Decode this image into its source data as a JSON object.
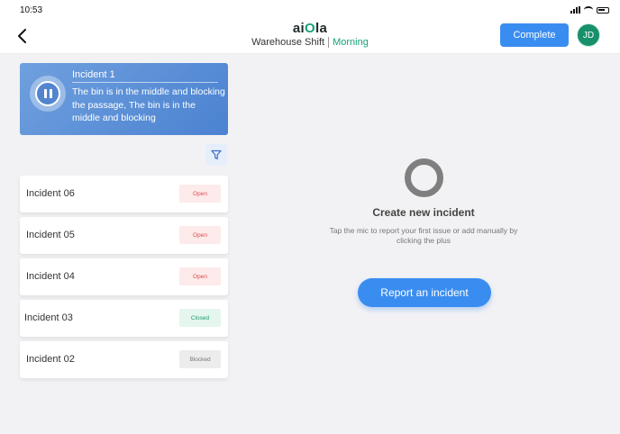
{
  "status_bar": {
    "time": "10:53"
  },
  "header": {
    "logo_prefix": "ai",
    "logo_o": "O",
    "logo_suffix": "la",
    "location": "Warehouse Shift",
    "shift": "Morning",
    "complete_label": "Complete",
    "avatar_initials": "JD",
    "back_icon": "chevron-left-icon"
  },
  "active_incident": {
    "title": "Incident 1",
    "description": "The bin is in the middle and blocking the passage, The bin is in the middle and blocking",
    "icon": "pause-icon"
  },
  "filter": {
    "icon": "filter-icon"
  },
  "incidents": [
    {
      "name": "Incident 06",
      "status": "Open"
    },
    {
      "name": "Incident 05",
      "status": "Open"
    },
    {
      "name": "Incident 04",
      "status": "Open"
    },
    {
      "name": "Incident 03",
      "status": "Closed"
    },
    {
      "name": "Incident 02",
      "status": "Blocked"
    }
  ],
  "empty_state": {
    "title": "Create new incident",
    "description": "Tap the mic to report your first issue or add manually by clicking the plus",
    "button_label": "Report an incident"
  },
  "colors": {
    "primary": "#3a8df0",
    "brand_green": "#17a07a",
    "open": "#e14b4b",
    "closed": "#1d9b6b",
    "blocked": "#777777"
  }
}
